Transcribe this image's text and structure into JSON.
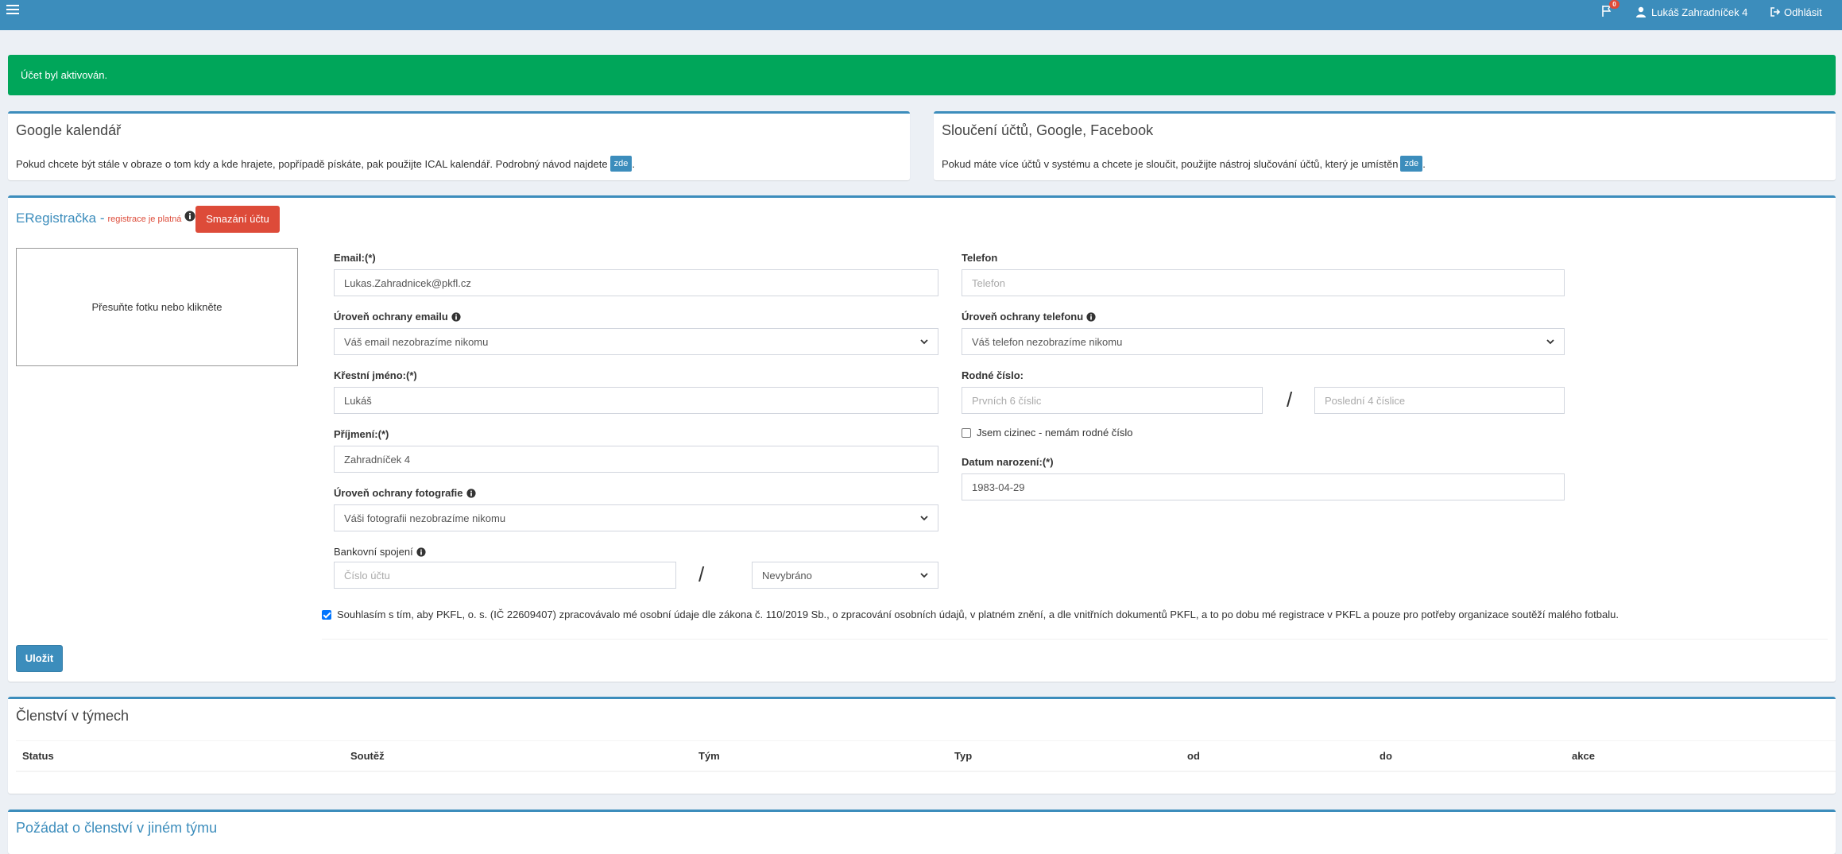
{
  "header": {
    "notifications_count": "0",
    "user_name": "Lukáš Zahradníček 4",
    "logout_label": "Odhlásit"
  },
  "alert": {
    "message": "Účet byl aktivován."
  },
  "google_calendar": {
    "title": "Google kalendář",
    "text": "Pokud chcete být stále v obraze o tom kdy a kde hrajete, popřípadě pískáte, pak použijte ICAL kalendář. Podrobný návod najdete",
    "link_label": "zde"
  },
  "merge_accounts": {
    "title": "Sloučení účtů, Google, Facebook",
    "text": "Pokud máte více účtů v systému a chcete je sloučit, použijte nástroj slučování účtů, který je umístěn",
    "link_label": "zde"
  },
  "registration": {
    "title": "ERegistračka -",
    "status": "registrace je platná",
    "delete_button": "Smazání účtu",
    "photo_placeholder": "Přesuňte fotku nebo klikněte",
    "email": {
      "label": "Email:(*)",
      "value": "Lukas.Zahradnicek@pkfl.cz"
    },
    "email_privacy": {
      "label": "Úroveň ochrany emailu",
      "selected": "Váš email nezobrazíme nikomu"
    },
    "first_name": {
      "label": "Křestní jméno:(*)",
      "value": "Lukáš"
    },
    "last_name": {
      "label": "Příjmení:(*)",
      "value": "Zahradníček 4"
    },
    "photo_privacy": {
      "label": "Úroveň ochrany fotografie",
      "selected": "Váši fotografii nezobrazíme nikomu"
    },
    "bank": {
      "label": "Bankovní spojení",
      "account_placeholder": "Číslo účtu",
      "separator": "/",
      "bank_selected": "Nevybráno"
    },
    "phone": {
      "label": "Telefon",
      "placeholder": "Telefon"
    },
    "phone_privacy": {
      "label": "Úroveň ochrany telefonu",
      "selected": "Váš telefon nezobrazíme nikomu"
    },
    "birth_number": {
      "label": "Rodné číslo:",
      "first_placeholder": "Prvních 6 číslic",
      "separator": "/",
      "last_placeholder": "Poslední 4 číslice"
    },
    "foreigner_label": "Jsem cizinec - nemám rodné číslo",
    "foreigner_checked": false,
    "birth_date": {
      "label": "Datum narození:(*)",
      "value": "1983-04-29"
    },
    "consent_label": "Souhlasím s tím, aby PKFL, o. s. (IČ 22609407) zpracovávalo mé osobní údaje dle zákona č. 110/2019 Sb., o zpracování osobních údajů, v platném znění, a dle vnitřních dokumentů PKFL, a to po dobu mé registrace v PKFL a pouze pro potřeby organizace soutěží malého fotbalu.",
    "consent_checked": true,
    "save_button": "Uložit"
  },
  "team_membership": {
    "title": "Členství v týmech",
    "columns": [
      "Status",
      "Soutěž",
      "Tým",
      "Typ",
      "od",
      "do",
      "akce"
    ]
  },
  "request_membership": {
    "title": "Požádat o členství v jiném týmu"
  },
  "colors": {
    "primary": "#3c8dbc",
    "success": "#00a65a",
    "danger": "#dd4b39",
    "background": "#ecf0f5"
  }
}
